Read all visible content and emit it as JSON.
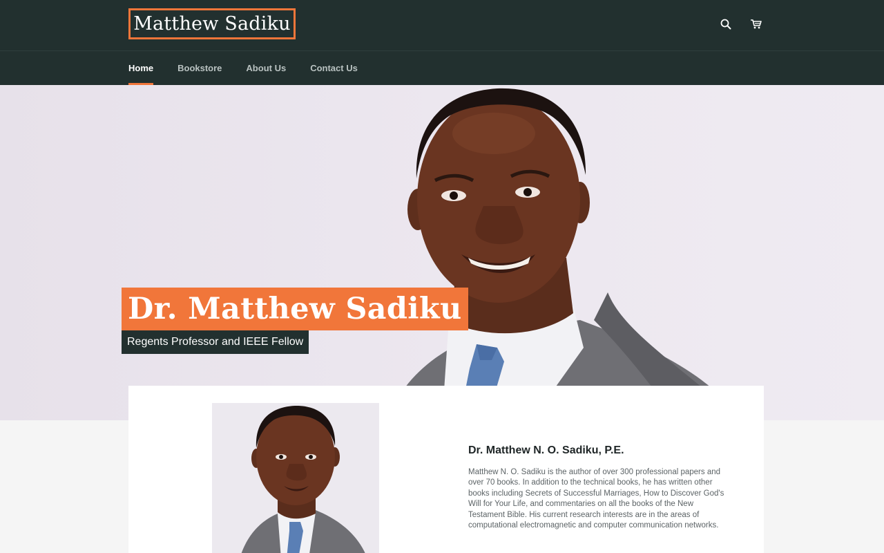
{
  "header": {
    "logo_text": "Matthew Sadiku",
    "icons": [
      "search-icon",
      "cart-icon"
    ]
  },
  "nav": {
    "items": [
      {
        "label": "Home",
        "active": true
      },
      {
        "label": "Bookstore",
        "active": false
      },
      {
        "label": "About Us",
        "active": false
      },
      {
        "label": "Contact Us",
        "active": false
      }
    ]
  },
  "hero": {
    "title": "Dr. Matthew Sadiku",
    "subtitle": "Regents Professor and IEEE Fellow"
  },
  "bio": {
    "name": "Dr. Matthew N. O. Sadiku, P.E.",
    "text": "Matthew N. O. Sadiku is the author of over 300 professional papers and over 70 books. In addition to the technical books, he has written other books including Secrets of Successful Marriages, How to Discover God's Will for Your Life, and commentaries on all the books of the New Testament Bible. His current research interests are in the areas of computational electromagnetic and computer communication networks."
  },
  "colors": {
    "header_bg": "#22302f",
    "accent": "#f1763a",
    "page_bg": "#f5f5f5"
  }
}
